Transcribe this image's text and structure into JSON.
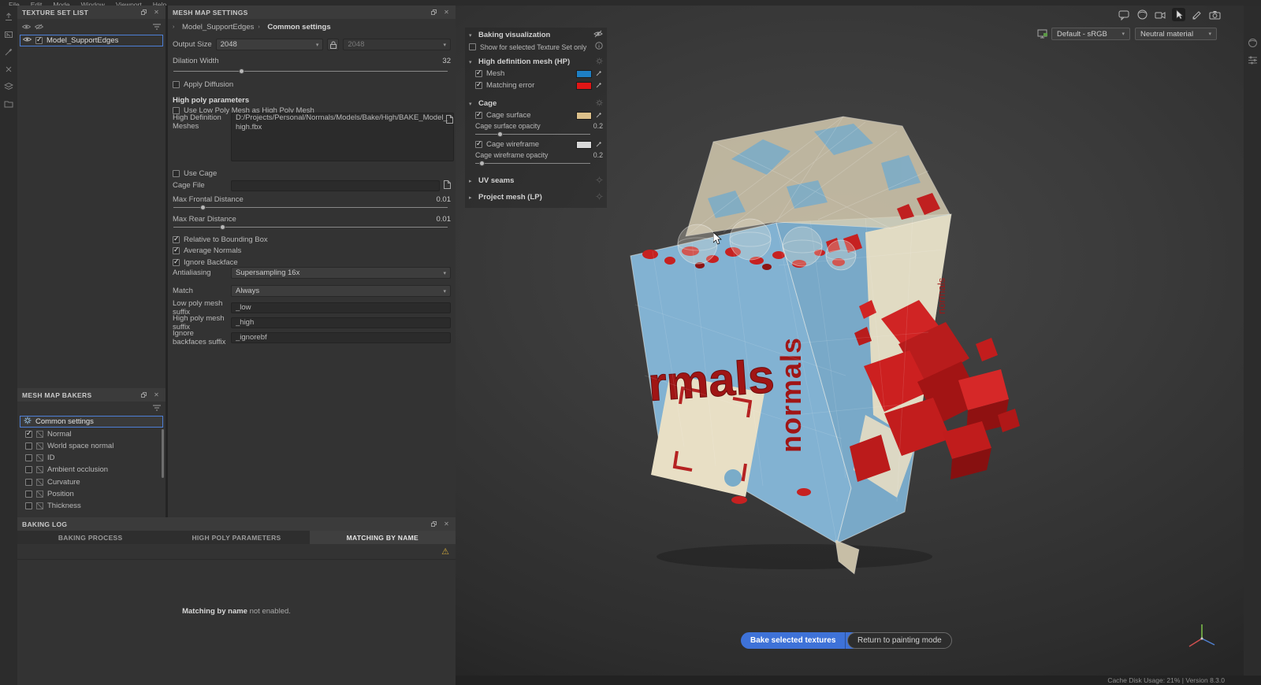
{
  "menu": {
    "items": [
      "File",
      "Edit",
      "Mode",
      "Window",
      "Viewport",
      "Help"
    ]
  },
  "icons": {
    "check": "✓",
    "warning": "⚠",
    "chevron_down": "▾",
    "chevron_right": "▸",
    "breadcrumb_sep": "›",
    "dropdown_arrow": "▾",
    "close": "✕"
  },
  "texture_set_list": {
    "title": "TEXTURE SET LIST",
    "item_label": "Model_SupportEdges"
  },
  "mesh_map_bakers": {
    "title": "MESH MAP BAKERS",
    "common_settings_label": "Common settings",
    "items": [
      {
        "label": "Normal"
      },
      {
        "label": "World space normal"
      },
      {
        "label": "ID"
      },
      {
        "label": "Ambient occlusion"
      },
      {
        "label": "Curvature"
      },
      {
        "label": "Position"
      },
      {
        "label": "Thickness"
      }
    ]
  },
  "mesh_map_settings": {
    "title": "MESH MAP SETTINGS",
    "breadcrumb": {
      "set": "Model_SupportEdges",
      "page": "Common settings"
    },
    "output_size": {
      "label": "Output Size",
      "value": "2048",
      "linked_value": "2048"
    },
    "dilation": {
      "label": "Dilation Width",
      "value": "32"
    },
    "apply_diffusion_label": "Apply Diffusion",
    "high_poly_header": "High poly parameters",
    "use_low_poly_label": "Use Low Poly Mesh as High Poly Mesh",
    "hd_meshes": {
      "label": "High Definition Meshes",
      "value": "D:/Projects/Personal/Normals/Models/Bake/High/BAKE_Model_high.fbx"
    },
    "use_cage_label": "Use Cage",
    "cage_file": {
      "label": "Cage File",
      "value": ""
    },
    "max_frontal": {
      "label": "Max Frontal Distance",
      "value": "0.01"
    },
    "max_rear": {
      "label": "Max Rear Distance",
      "value": "0.01"
    },
    "relative_bb_label": "Relative to Bounding Box",
    "average_normals_label": "Average Normals",
    "ignore_backface_label": "Ignore Backface",
    "antialiasing": {
      "label": "Antialiasing",
      "value": "Supersampling 16x"
    },
    "match": {
      "label": "Match",
      "value": "Always"
    },
    "low_suffix": {
      "label": "Low poly mesh suffix",
      "value": "_low"
    },
    "high_suffix": {
      "label": "High poly mesh suffix",
      "value": "_high"
    },
    "ignore_suffix": {
      "label": "Ignore backfaces suffix",
      "value": "_ignorebf"
    }
  },
  "baking_log": {
    "title": "BAKING LOG",
    "tabs": [
      {
        "label": "BAKING PROCESS"
      },
      {
        "label": "HIGH POLY PARAMETERS"
      },
      {
        "label": "MATCHING BY NAME"
      }
    ],
    "message_bold": "Matching by name",
    "message_rest": " not enabled."
  },
  "visualization": {
    "header": "Baking visualization",
    "show_selected_label": "Show for selected Texture Set only",
    "hp_header": "High definition mesh (HP)",
    "mesh_label": "Mesh",
    "mesh_color": "#1e7fc4",
    "matching_error_label": "Matching error",
    "matching_error_color": "#e01616",
    "cage_header": "Cage",
    "cage_surface_label": "Cage surface",
    "cage_surface_color": "#dcc08a",
    "cage_surface_opacity_label": "Cage surface opacity",
    "cage_surface_opacity_value": "0.2",
    "cage_wireframe_label": "Cage wireframe",
    "cage_wireframe_color": "#d8d8d8",
    "cage_wireframe_opacity_label": "Cage wireframe opacity",
    "cage_wireframe_opacity_value": "0.2",
    "uv_seams_header": "UV seams",
    "project_mesh_header": "Project mesh (LP)"
  },
  "viewport": {
    "display_mode": "Default - sRGB",
    "material_mode": "Neutral material",
    "bake_button_label": "Bake selected textures",
    "bake_button_color": "#3e72d8",
    "return_button_label": "Return to painting mode",
    "model_text_front": "rmals",
    "model_text_side": "normals",
    "status_text": "Cache Disk Usage: 21% | Version 8.3.0"
  }
}
